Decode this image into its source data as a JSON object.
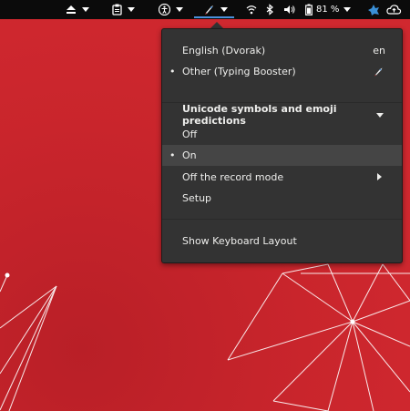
{
  "topbar": {
    "items": [
      {
        "icon": "eject-icon"
      },
      {
        "icon": "clipboard-icon"
      },
      {
        "icon": "accessibility-icon"
      },
      {
        "icon": "input-method-icon"
      },
      {
        "icon": "wifi-icon"
      },
      {
        "icon": "bluetooth-icon"
      },
      {
        "icon": "volume-icon"
      },
      {
        "icon": "battery-icon"
      },
      {
        "icon": "network-extension-icon"
      },
      {
        "icon": "cloud-sync-icon"
      }
    ],
    "battery_percent": "81 %",
    "active_indicator_color": "#4a90d9"
  },
  "menu": {
    "languages": [
      {
        "label": "English (Dvorak)",
        "right": "en",
        "selected": false
      },
      {
        "label": "Other (Typing Booster)",
        "right_icon": "rocket-icon",
        "selected": true
      }
    ],
    "section_title": "Unicode symbols and emoji predictions",
    "options": [
      {
        "label": "Off",
        "selected": false
      },
      {
        "label": "On",
        "selected": true
      }
    ],
    "record_mode_label": "Off the record mode",
    "setup_label": "Setup",
    "show_layout_label": "Show Keyboard Layout"
  },
  "colors": {
    "wallpaper": "#c9252c",
    "menu_bg": "#333333",
    "highlight": "#454545"
  }
}
